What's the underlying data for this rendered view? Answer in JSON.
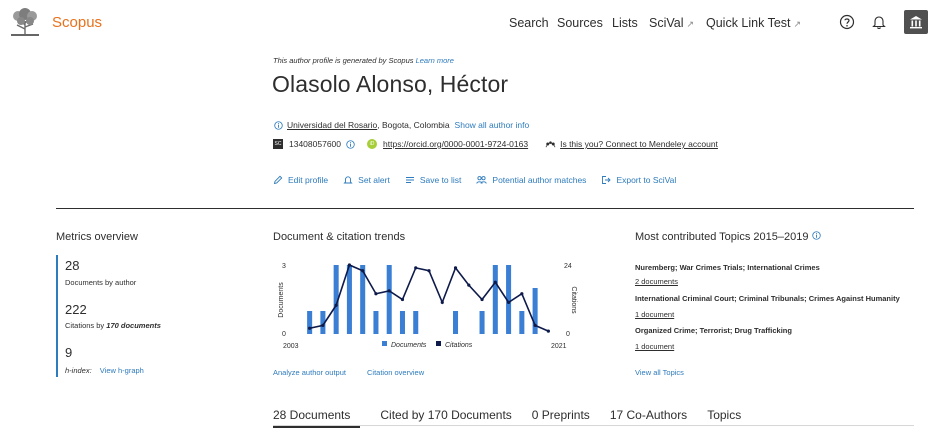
{
  "header": {
    "brand": "Scopus",
    "nav": [
      {
        "label": "Search",
        "external": false
      },
      {
        "label": "Sources",
        "external": false
      },
      {
        "label": "Lists",
        "external": false
      },
      {
        "label": "SciVal",
        "external": true
      },
      {
        "label": "Quick Link Test",
        "external": true
      }
    ],
    "ext_glyph": "↗",
    "icons": [
      "help-icon",
      "bell-icon",
      "institution-icon"
    ]
  },
  "profile": {
    "generated_note": "This author profile is generated by Scopus",
    "learn_more": "Learn more",
    "name": "Olasolo Alonso, Héctor",
    "affiliation": "Universidad del Rosario",
    "location": ", Bogota, Colombia",
    "show_all": "Show all author info",
    "scopus_id": "13408057600",
    "sc_badge": "SC",
    "orcid_badge": "iD",
    "orcid": "https://orcid.org/0000-0001-9724-0163",
    "mendeley": "Is this you? Connect to Mendeley account"
  },
  "actions": [
    {
      "label": "Edit profile",
      "icon": "pencil-icon"
    },
    {
      "label": "Set alert",
      "icon": "bell-icon"
    },
    {
      "label": "Save to list",
      "icon": "list-icon"
    },
    {
      "label": "Potential author matches",
      "icon": "people-icon"
    },
    {
      "label": "Export to SciVal",
      "icon": "export-icon"
    }
  ],
  "metrics": {
    "title": "Metrics overview",
    "documents": "28",
    "documents_label": "Documents by author",
    "citations": "222",
    "citations_label_pre": "Citations by",
    "citations_label_b": "170 documents",
    "hindex": "9",
    "hindex_label": "h-index:",
    "view_hgraph": "View h-graph"
  },
  "trends": {
    "title": "Document & citation trends",
    "analyze_link": "Analyze author output",
    "citation_link": "Citation overview"
  },
  "chart_data": {
    "type": "bar",
    "x_start": "2003",
    "x_end": "2021",
    "ylabel_left": "Documents",
    "ylabel_right": "Citations",
    "left_max": "3",
    "left_min": "0",
    "right_max": "24",
    "right_min": "0",
    "ylim_left": [
      0,
      3
    ],
    "ylim_right": [
      0,
      24
    ],
    "legend": [
      "Documents",
      "Citations"
    ],
    "series": [
      {
        "name": "Documents",
        "type": "bar",
        "color": "#3a7fd4",
        "values": [
          1,
          1,
          3,
          3,
          3,
          1,
          3,
          1,
          1,
          0,
          0,
          1,
          0,
          1,
          3,
          3,
          1,
          2,
          0
        ]
      },
      {
        "name": "Citations",
        "type": "line",
        "color": "#0d1a4a",
        "values": [
          2,
          3,
          10,
          24,
          22,
          14,
          15,
          12,
          23,
          22,
          11,
          23,
          17,
          12,
          18,
          11,
          14,
          3,
          1
        ]
      }
    ]
  },
  "topics": {
    "title": "Most contributed Topics 2015–2019",
    "items": [
      {
        "title": "Nuremberg; War Crimes Trials; International Crimes",
        "count": "2 documents"
      },
      {
        "title": "International Criminal Court; Criminal Tribunals; Crimes Against Humanity",
        "count": "1 document"
      },
      {
        "title": "Organized Crime; Terrorist; Drug Trafficking",
        "count": "1 document"
      }
    ],
    "view_all": "View all Topics"
  },
  "tabs": [
    "28 Documents",
    "Cited by 170 Documents",
    "0 Preprints",
    "17 Co-Authors",
    "Topics"
  ],
  "colors": {
    "brand": "#e9711c",
    "link": "#2e7bbd",
    "bar": "#3a7fd4",
    "line": "#0d1a4a"
  }
}
